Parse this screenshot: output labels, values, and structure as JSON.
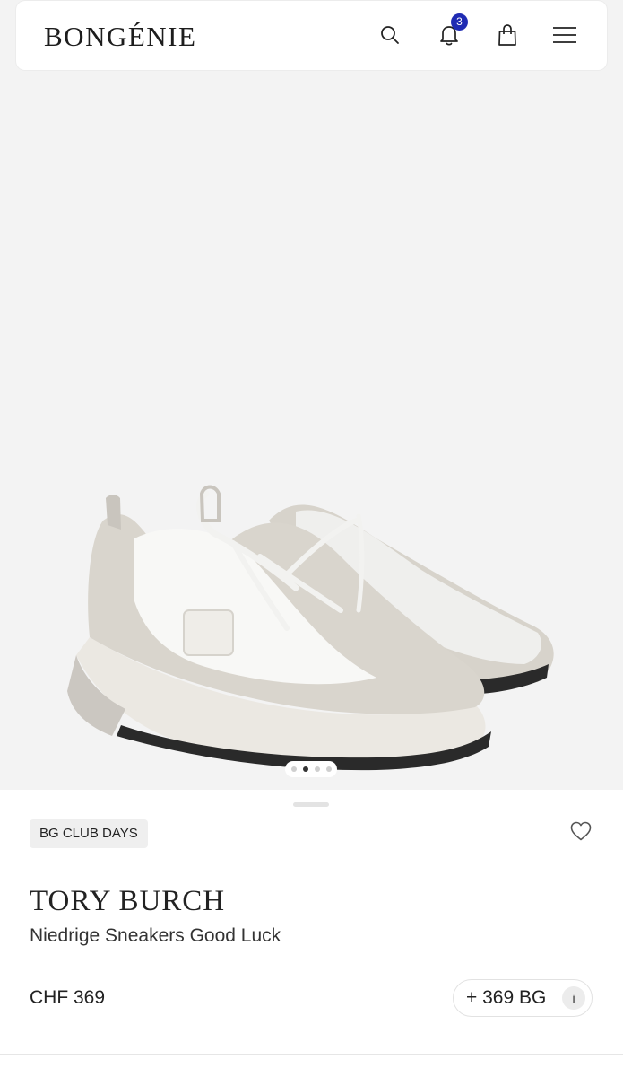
{
  "header": {
    "logo": "BONGÉNIE",
    "notification_count": "3",
    "icons": [
      "search-icon",
      "bell-icon",
      "shopping-bag-icon",
      "menu-icon"
    ],
    "badge_color": "#1f2bb3"
  },
  "gallery": {
    "image_count": 4,
    "active_index": 1
  },
  "product": {
    "tag": "BG CLUB DAYS",
    "brand": "TORY BURCH",
    "name": "Niedrige Sneakers Good Luck",
    "price": "CHF 369",
    "points": "+ 369 BG",
    "points_info": "i"
  }
}
